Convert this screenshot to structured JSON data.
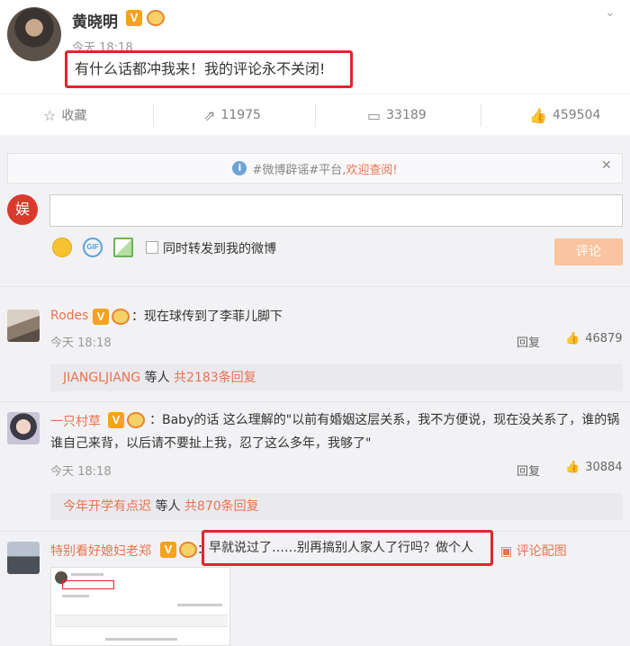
{
  "post": {
    "author": "黄晓明",
    "verified_badge": "V",
    "time": "今天 18:18",
    "text": "有什么话都冲我来！我的评论永不关闭!",
    "more_icon": "chevron-down-icon"
  },
  "actions": {
    "favorite_label": "收藏",
    "repost_count": "11975",
    "comment_count": "33189",
    "like_count": "459504"
  },
  "notice": {
    "prefix": "#微博辟谣#平台,",
    "link": "欢迎查阅!"
  },
  "composer": {
    "avatar_text": "娱",
    "gif_label": "GIF",
    "repost_checkbox_label": "同时转发到我的微博",
    "submit_label": "评论"
  },
  "comments": [
    {
      "name": "Rodes",
      "badge": "V",
      "text": "：现在球传到了李菲儿脚下",
      "time": "今天 18:18",
      "reply_label": "回复",
      "likes": "46879",
      "subreply_name": "JIANGLJIANG",
      "subreply_mid": " 等人 ",
      "subreply_count": "共2183条回复"
    },
    {
      "name": "一只村草",
      "badge": "V",
      "text": "：Baby的话 这么理解的\"以前有婚姻这层关系，我不方便说，现在没关系了，谁的锅谁自己来背，以后请不要扯上我，忍了这么多年，我够了\"",
      "time": "今天 18:18",
      "reply_label": "回复",
      "likes": "30884",
      "subreply_name": "今年开学有点迟",
      "subreply_mid": " 等人 ",
      "subreply_count": "共870条回复"
    },
    {
      "name": "特别看好媳妇老郑",
      "badge": "V",
      "text": "早就说过了……别再搞别人家人了行吗？做个人",
      "pic_link": "评论配图"
    }
  ],
  "colors": {
    "accent": "#eb7350",
    "highlight_box": "#e0262e",
    "badge": "#f7a21b"
  }
}
